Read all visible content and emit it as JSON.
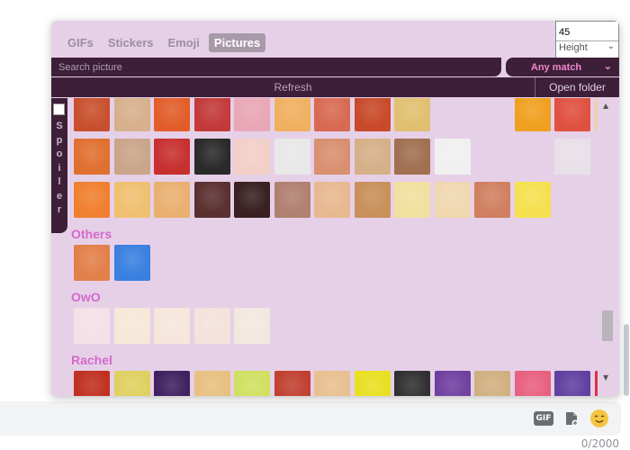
{
  "tabs": [
    {
      "label": "GIFs",
      "active": false
    },
    {
      "label": "Stickers",
      "active": false
    },
    {
      "label": "Emoji",
      "active": false
    },
    {
      "label": "Pictures",
      "active": true
    }
  ],
  "size_control": {
    "value": "45",
    "mode": "Height"
  },
  "search": {
    "placeholder": "Search picture",
    "match_mode": "Any match"
  },
  "toolbar": {
    "refresh_label": "Refresh",
    "open_folder_label": "Open folder"
  },
  "spoiler": {
    "label": "Spoiler",
    "checked": false
  },
  "sections": [
    {
      "title": "",
      "rows": [
        [
          "#c8502e",
          "#d7b08c",
          "#e25d2a",
          "#c33a3a",
          "#e8a6b6",
          "#f0b060",
          "#d86a52",
          "#c84a2a",
          "#e0c070",
          "",
          "",
          "#f0a020",
          "#e05040",
          "#f2cfa0",
          "#d9b08a"
        ],
        [
          "#e07030",
          "#c9a58a",
          "#c83030",
          "#2a2a2a",
          "#f2d0c8",
          "#e8e8e8",
          "#d89070",
          "#d5b088",
          "#a07050",
          "#f0f0f0",
          "",
          "",
          "#e8e0e8"
        ],
        [
          "#f08030",
          "#f0c070",
          "#e9b070",
          "#5a3030",
          "#3a2020",
          "#b08070",
          "#e8b890",
          "#c8905a",
          "#f2e0a0",
          "#f0d8b0",
          "#d08060",
          "#f5e050"
        ]
      ]
    },
    {
      "title": "Others",
      "rows": [
        [
          "#e2804a",
          "#3a80e0"
        ]
      ]
    },
    {
      "title": "OwO",
      "rows": [
        [
          "#f5e0e8",
          "#f5e8d8",
          "#f6e6dc",
          "#f4e2dc",
          "#f2e8e0"
        ]
      ]
    },
    {
      "title": "Rachel",
      "rows": [
        [
          "#c03020",
          "#e0d060",
          "#402060",
          "#e8c080",
          "#d0e060",
          "#c04030",
          "#e8c090",
          "#e8e020",
          "#303030",
          "#7040a0",
          "#d0b080",
          "#e86080",
          "#6040a0",
          "#e03040"
        ],
        [
          "#6a5a8a",
          "#e0c040",
          "#404060"
        ]
      ]
    }
  ],
  "chat": {
    "char_counter": "0/2000",
    "gif_button": "GIF"
  },
  "icons": {
    "file": "file-upload-icon",
    "emoji": "emoji-icon"
  },
  "colors": {
    "panel": "#e6d0e8",
    "dark": "#3d1f37",
    "section_title": "#d36ac9",
    "active_tab": "#a99aa9"
  }
}
